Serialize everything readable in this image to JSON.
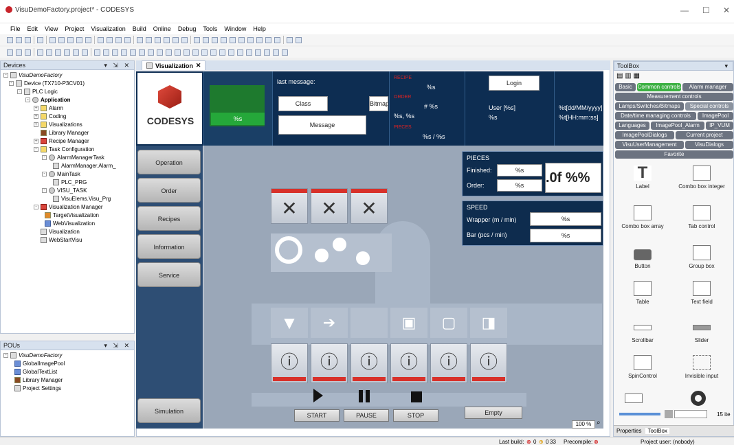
{
  "window": {
    "title": "VisuDemoFactory.project* - CODESYS",
    "minimize": "—",
    "maximize": "☐",
    "close": "✕"
  },
  "menu": [
    "File",
    "Edit",
    "View",
    "Project",
    "Visualization",
    "Build",
    "Online",
    "Debug",
    "Tools",
    "Window",
    "Help"
  ],
  "devices": {
    "title": "Devices",
    "controls": "▾ ⇲ ✕",
    "tree": [
      "VisuDemoFactory",
      "Device (TX710-P3CV01)",
      "PLC Logic",
      "Application",
      "Alarm",
      "Coding",
      "Visualizations",
      "Library Manager",
      "Recipe Manager",
      "Task Configuration",
      "AlarmManagerTask",
      "AlarmManager.Alarm_",
      "MainTask",
      "PLC_PRG",
      "VISU_TASK",
      "VisuElems.Visu_Prg",
      "Visualization Manager",
      "TargetVisualization",
      "WebVisualization",
      "Visualization",
      "WebStartVisu"
    ]
  },
  "pous": {
    "title": "POUs",
    "controls": "▾ ⇲ ✕",
    "tree": [
      "VisuDemoFactory",
      "GlobalImagePool",
      "GlobalTextList",
      "Library Manager",
      "Project Settings"
    ]
  },
  "editor": {
    "tab": "Visualization",
    "close": "✕"
  },
  "header": {
    "brand": "CODESYS",
    "machine_value": "%s",
    "last_message_label": "last message:",
    "class_btn": "Class",
    "bitmap_btn": "Bitmap",
    "message_btn": "Message",
    "status_red": [
      "RECIPE",
      "ORDER",
      "PIECES"
    ],
    "recipe_val": "%s",
    "order_val": "# %s",
    "order_sub": "%s,  %s",
    "pieces_val": "%s / %s",
    "login_btn": "Login",
    "user_label": "User [%s]",
    "user_val": "%s",
    "date_fmt": "%t[dd/MM/yyyy]",
    "time_fmt": "%t[HH:mm:ss]"
  },
  "nav": [
    "Operation",
    "Order",
    "Recipes",
    "Information",
    "Service",
    "Simulation"
  ],
  "pieces_panel": {
    "title": "PIECES",
    "finished_label": "Finished:",
    "finished_val": "%s",
    "order_label": "Order:",
    "order_val": "%s",
    "big": ".0f %%"
  },
  "speed_panel": {
    "title": "SPEED",
    "wrapper_label": "Wrapper (m / min)",
    "wrapper_val": "%s",
    "bar_label": "Bar (pcs / min)",
    "bar_val": "%s"
  },
  "controls": {
    "start": "START",
    "pause": "PAUSE",
    "stop": "STOP",
    "empty": "Empty",
    "zoom": "100 %"
  },
  "toolbox": {
    "title": "ToolBox",
    "tabs": [
      "Basic",
      "Common controls",
      "Alarm manager",
      "Measurement controls",
      "Lamps/Switches/Bitmaps",
      "Special controls",
      "Date/time managing controls",
      "ImagePool",
      "Languages",
      "ImagePool_Alarm",
      "IP_VUM",
      "ImagePoolDialogs",
      "Current project",
      "VisuUserManagement",
      "VisuDialogs",
      "Favorite"
    ],
    "items": [
      "Label",
      "Combo box integer",
      "Combo box array",
      "Tab control",
      "Button",
      "Group box",
      "Table",
      "Text field",
      "Scrollbar",
      "Slider",
      "SpinControl",
      "Invisible input"
    ],
    "count": "15 ite",
    "props_tab": "Properties",
    "toolbox_tab": "ToolBox"
  },
  "status": {
    "last_build": "Last build:",
    "errors": "0",
    "warnings": "0",
    "msgs": "33",
    "precompile": "Precompile:",
    "user": "Project user: (nobody)"
  }
}
